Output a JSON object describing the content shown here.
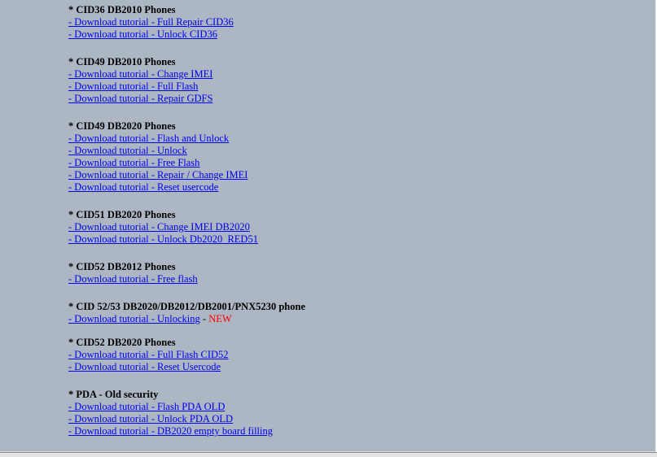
{
  "sections": [
    {
      "heading": "* CID36 DB2010 Phones",
      "links": [
        "- Download tutorial - Full Repair CID36",
        "- Download tutorial - Unlock CID36"
      ]
    },
    {
      "heading": "* CID49 DB2010 Phones",
      "links": [
        "- Download tutorial - Change IMEI",
        "- Download tutorial - Full Flash",
        "- Download tutorial - Repair GDFS"
      ]
    },
    {
      "heading": "* CID49 DB2020 Phones",
      "links": [
        "- Download tutorial - Flash and Unlock",
        "- Download tutorial - Unlock",
        "- Download tutorial - Free Flash",
        "- Download tutorial - Repair / Change IMEI",
        "- Download tutorial - Reset usercode"
      ]
    },
    {
      "heading": "* CID51 DB2020 Phones",
      "links": [
        "- Download tutorial - Change IMEI DB2020",
        "- Download tutorial - Unlock Db2020_RED51"
      ]
    },
    {
      "heading": "* CID52 DB2012 Phones",
      "links": [
        "- Download tutorial - Free flash"
      ]
    },
    {
      "heading": "* CID 52/53 DB2020/DB2012/DB2001/PNX5230 phone",
      "links": [
        "- Download tutorial - Unlocking"
      ],
      "separator": " - ",
      "badge": "NEW"
    },
    {
      "heading": "* CID52 DB2020 Phones",
      "links": [
        "- Download tutorial - Full Flash CID52",
        "- Download tutorial - Reset Usercode"
      ]
    },
    {
      "heading": "* PDA - Old security",
      "links": [
        "- Download tutorial - Flash PDA OLD",
        "- Download tutorial - Unlock PDA OLD",
        "- Download tutorial - DB2020 empty board filling"
      ]
    }
  ],
  "colors": {
    "background": "#adb6c3",
    "link": "#0000ee",
    "badge": "#ff0000"
  }
}
